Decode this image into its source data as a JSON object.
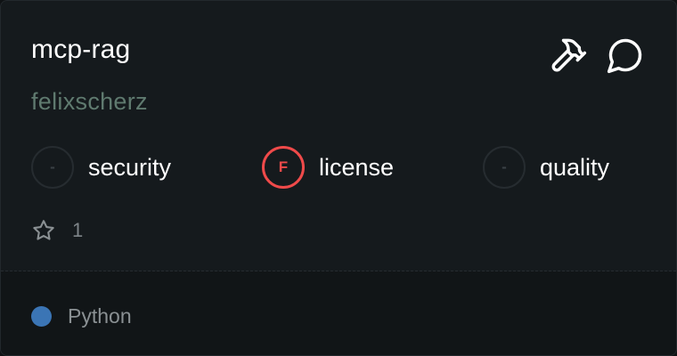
{
  "card": {
    "title": "mcp-rag",
    "author": "felixscherz"
  },
  "actions": [
    {
      "icon": "hammer-icon"
    },
    {
      "icon": "chat-bubble-icon"
    }
  ],
  "scores": [
    {
      "label": "security",
      "grade": "-",
      "status": "none"
    },
    {
      "label": "license",
      "grade": "F",
      "status": "fail",
      "color": "#ef4a4a"
    },
    {
      "label": "quality",
      "grade": "-",
      "status": "none"
    }
  ],
  "stars": {
    "icon": "star-icon",
    "count": "1"
  },
  "language": {
    "name": "Python",
    "color": "#3b75b5"
  }
}
